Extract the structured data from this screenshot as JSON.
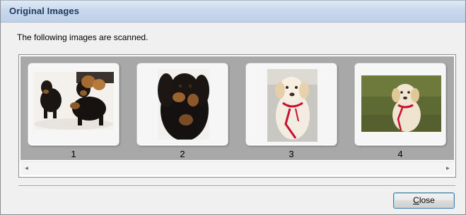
{
  "window": {
    "title": "Original Images"
  },
  "description": "The following images are scanned.",
  "thumbnails": [
    {
      "number": "1",
      "subject": "two black-and-tan dachshunds on white background"
    },
    {
      "number": "2",
      "subject": "black-and-tan dachshund close-up"
    },
    {
      "number": "3",
      "subject": "white labrador with red leash on gray floor"
    },
    {
      "number": "4",
      "subject": "white labrador with red leash on grass"
    }
  ],
  "scrollbar": {
    "left_arrow": "◄",
    "right_arrow": "►"
  },
  "buttons": {
    "close_first": "C",
    "close_rest": "lose"
  }
}
